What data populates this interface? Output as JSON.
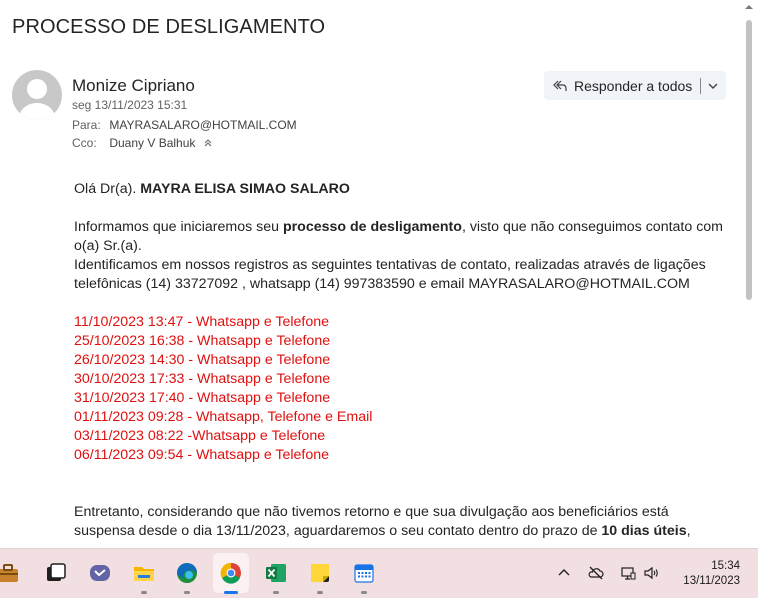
{
  "subject": "PROCESSO DE DESLIGAMENTO",
  "sender": {
    "name": "Monize Cipriano",
    "date": "seg 13/11/2023 15:31",
    "to_label": "Para:",
    "to": "MAYRASALARO@HOTMAIL.COM",
    "cc_label": "Cco:",
    "cc": "Duany V Balhuk"
  },
  "reply": {
    "label": "Responder a todos"
  },
  "body": {
    "greeting_prefix": "Olá Dr(a). ",
    "greeting_name": "MAYRA ELISA SIMAO SALARO",
    "p1_a": "Informamos que iniciaremos seu ",
    "p1_bold": "processo de desligamento",
    "p1_b": ", visto que não conseguimos contato com o(a) Sr.(a).",
    "p2": "Identificamos em nossos registros as seguintes tentativas de contato, realizadas através de ligações telefônicas (14) 33727092 , whatsapp (14) 997383590 e email  MAYRASALARO@HOTMAIL.COM",
    "attempts": [
      "11/10/2023 13:47 - Whatsapp e Telefone",
      "25/10/2023 16:38 - Whatsapp e Telefone",
      "26/10/2023 14:30 - Whatsapp e Telefone",
      "30/10/2023 17:33 - Whatsapp e Telefone",
      "31/10/2023 17:40 - Whatsapp e Telefone",
      "01/11/2023 09:28 - Whatsapp, Telefone e Email",
      "03/11/2023 08:22 -Whatsapp e Telefone",
      "06/11/2023 09:54 - Whatsapp e Telefone"
    ],
    "p3_a": "Entretanto, considerando que não tivemos retorno e que sua divulgação aos beneficiários está suspensa desde o dia 13/11/2023, aguardaremos o seu contato dentro do prazo de ",
    "p3_bold": "10 dias úteis",
    "p3_b": ","
  },
  "taskbar": {
    "time": "15:34",
    "date": "13/11/2023",
    "apps": [
      "briefcase-icon",
      "task-view-icon",
      "teams-icon",
      "file-explorer-icon",
      "edge-icon",
      "chrome-icon",
      "excel-icon",
      "sticky-notes-icon",
      "calendar-icon"
    ]
  }
}
